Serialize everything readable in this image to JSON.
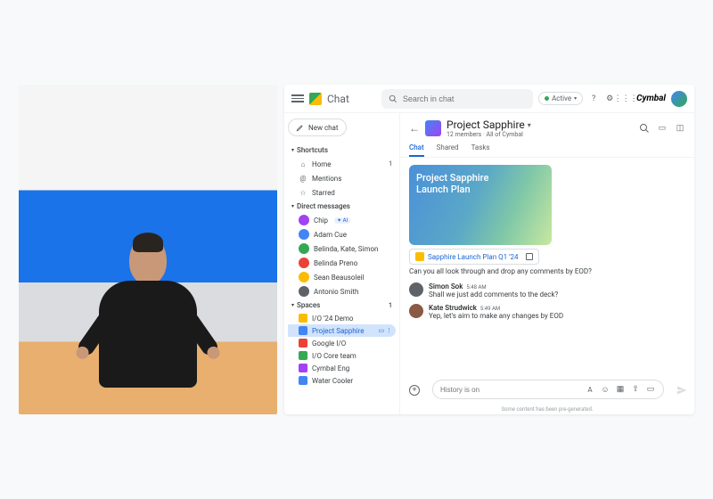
{
  "app_title": "Chat",
  "search_placeholder": "Search in chat",
  "status_label": "Active",
  "brand": "Cymbal",
  "new_chat_label": "New chat",
  "sidebar": {
    "shortcuts_label": "Shortcuts",
    "home_label": "Home",
    "mentions_label": "Mentions",
    "starred_label": "Starred",
    "dm_label": "Direct messages",
    "dms": [
      {
        "name": "Chip",
        "ai": true,
        "color": "#a142f4"
      },
      {
        "name": "Adam Cue",
        "color": "#4285f4"
      },
      {
        "name": "Belinda, Kate, Simon",
        "color": "#34a853"
      },
      {
        "name": "Belinda Preno",
        "color": "#ea4335"
      },
      {
        "name": "Sean Beausoleil",
        "color": "#fbbc04"
      },
      {
        "name": "Antonio Smith",
        "color": "#5f6368"
      }
    ],
    "spaces_label": "Spaces",
    "spaces": [
      {
        "name": "I/O '24 Demo",
        "color": "#fbbc04",
        "selected": false
      },
      {
        "name": "Project Sapphire",
        "color": "#4285f4",
        "selected": true
      },
      {
        "name": "Google I/O",
        "color": "#ea4335",
        "selected": false
      },
      {
        "name": "I/O Core team",
        "color": "#34a853",
        "selected": false
      },
      {
        "name": "Cymbal Eng",
        "color": "#a142f4",
        "selected": false
      },
      {
        "name": "Water Cooler",
        "color": "#4285f4",
        "selected": false
      }
    ]
  },
  "space": {
    "title": "Project Sapphire",
    "subtitle": "12 members · All of Cymbal",
    "tabs": [
      "Chat",
      "Shared",
      "Tasks"
    ],
    "active_tab": 0
  },
  "preview": {
    "title": "Project Sapphire\nLaunch Plan",
    "attachment_name": "Sapphire Launch Plan Q1 '24",
    "first_message": "Can you all look through and drop any comments by EOD?"
  },
  "messages": [
    {
      "author": "Simon Sok",
      "time": "5:48 AM",
      "text": "Shall we just add comments to the deck?",
      "color": "#5f6368"
    },
    {
      "author": "Kate Strudwick",
      "time": "5:49 AM",
      "text": "Yep, let's aim to make any changes by EOD",
      "color": "#8a5a44"
    }
  ],
  "composer_placeholder": "History is on",
  "footer_note": "Some content has been pre-generated.",
  "ai_badge": "✦ AI"
}
